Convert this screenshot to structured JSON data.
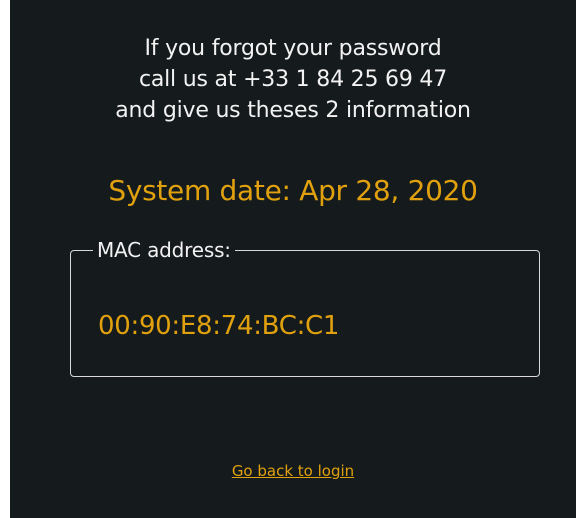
{
  "info": {
    "line1": "If you forgot your password",
    "line2": "call us at +33 1 84 25 69 47",
    "line3": "and give us theses 2 information"
  },
  "system_date": "System date: Apr 28, 2020",
  "mac": {
    "label": "MAC address:",
    "value": "00:90:E8:74:BC:C1"
  },
  "back_link": "Go back to login",
  "colors": {
    "background": "#151a1c",
    "accent": "#e1a10e",
    "text": "#f2f2f2"
  }
}
